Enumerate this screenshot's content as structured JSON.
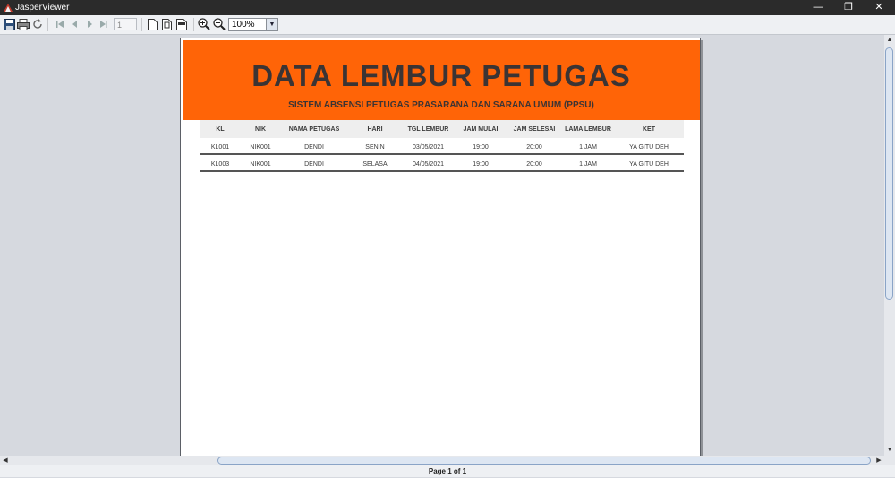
{
  "window": {
    "title": "JasperViewer"
  },
  "toolbar": {
    "page_number": "1",
    "zoom": "100%"
  },
  "report": {
    "title": "DATA LEMBUR PETUGAS",
    "subtitle": "SISTEM ABSENSI PETUGAS PRASARANA DAN SARANA UMUM (PPSU)",
    "banner_color": "#ff6407",
    "columns": [
      "KL",
      "NIK",
      "NAMA PETUGAS",
      "HARI",
      "TGL LEMBUR",
      "JAM MULAI",
      "JAM SELESAI",
      "LAMA LEMBUR",
      "KET"
    ],
    "rows": [
      [
        "KL001",
        "NIK001",
        "DENDI",
        "SENIN",
        "03/05/2021",
        "19:00",
        "20:00",
        "1 JAM",
        "YA GITU DEH"
      ],
      [
        "KL003",
        "NIK001",
        "DENDI",
        "SELASA",
        "04/05/2021",
        "19:00",
        "20:00",
        "1 JAM",
        "YA GITU DEH"
      ]
    ]
  },
  "status": {
    "page_label": "Page 1 of 1"
  }
}
